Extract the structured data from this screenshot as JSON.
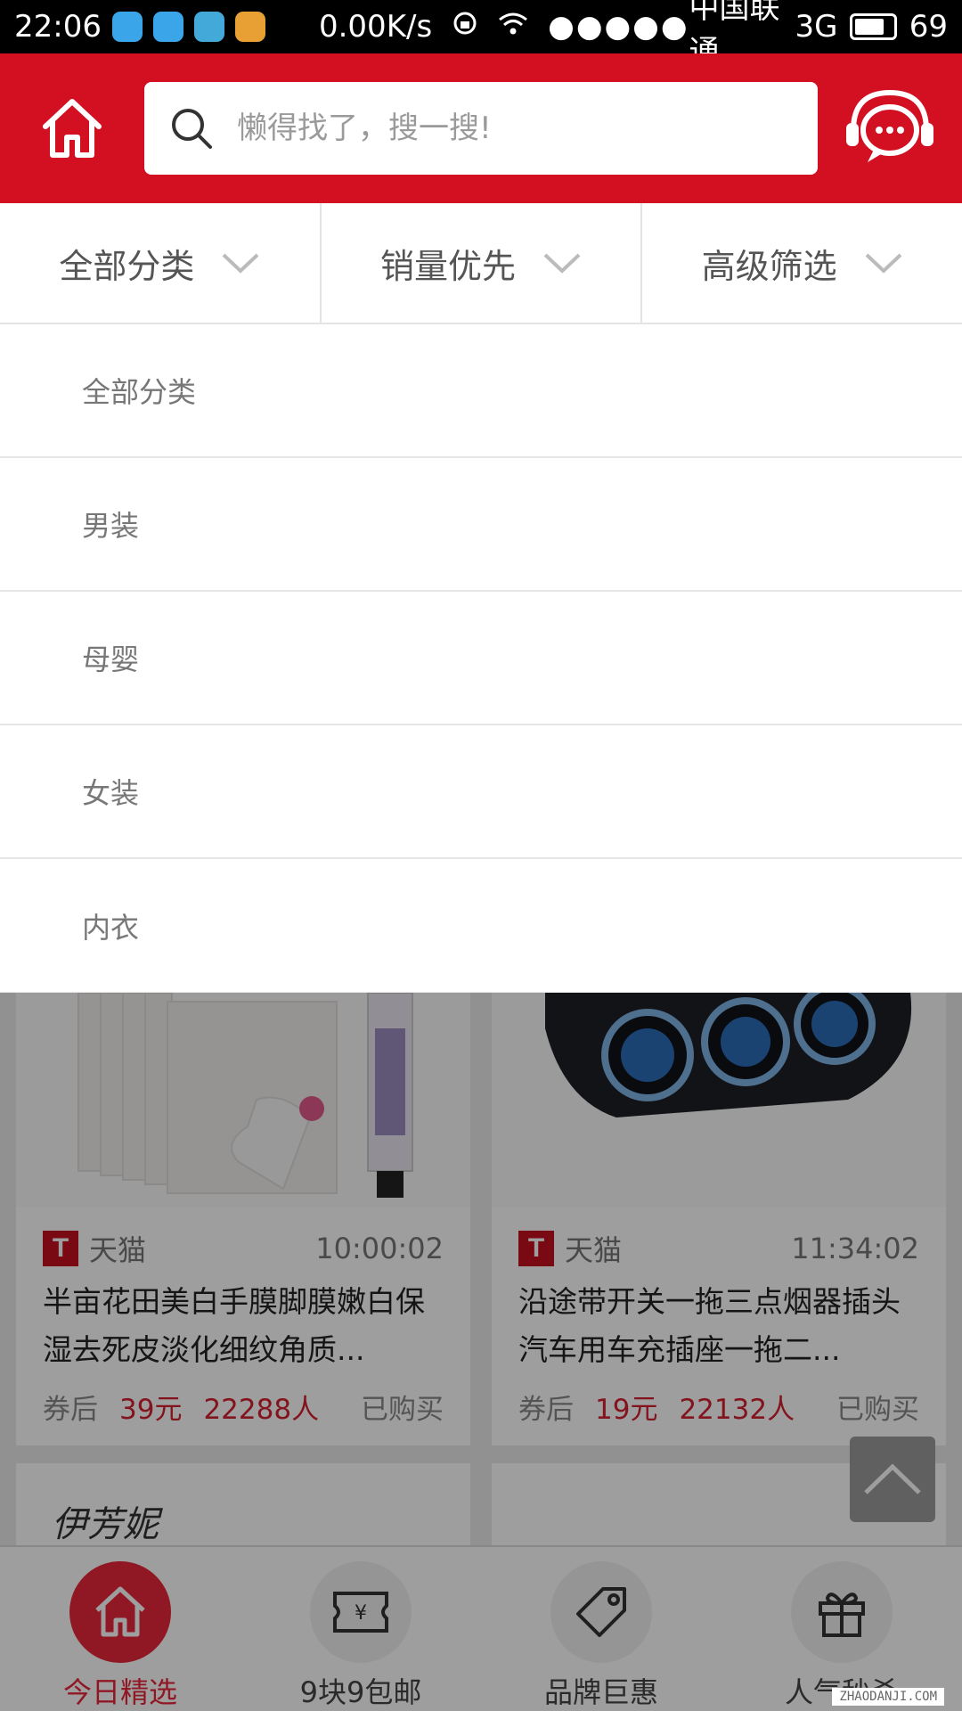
{
  "status_bar": {
    "time": "22:06",
    "net_speed": "0.00K/s",
    "carrier": "中国联通",
    "network": "3G",
    "battery": "69"
  },
  "header": {
    "search_placeholder": "懒得找了，搜一搜!"
  },
  "filters": [
    {
      "label": "全部分类"
    },
    {
      "label": "销量优先"
    },
    {
      "label": "高级筛选"
    }
  ],
  "dropdown": {
    "items": [
      "全部分类",
      "男装",
      "母婴",
      "女装",
      "内衣"
    ]
  },
  "products": [
    {
      "shop": "天猫",
      "shop_badge": "T",
      "time": "10:00:02",
      "title": "半亩花田美白手膜脚膜嫩白保湿去死皮淡化细纹角质...",
      "coupon_label": "券后",
      "price": "39元",
      "buyers": "22288人",
      "bought_label": "已购买"
    },
    {
      "shop": "天猫",
      "shop_badge": "T",
      "time": "11:34:02",
      "title": "沿途带开关一拖三点烟器插头汽车用车充插座一拖二...",
      "coupon_label": "券后",
      "price": "19元",
      "buyers": "22132人",
      "bought_label": "已购买"
    }
  ],
  "brand_logo_text": "伊芳妮",
  "bottom_nav": [
    {
      "label": "今日精选",
      "icon": "home-icon",
      "active": true
    },
    {
      "label": "9块9包邮",
      "icon": "yen-ticket-icon",
      "active": false
    },
    {
      "label": "品牌巨惠",
      "icon": "tag-icon",
      "active": false
    },
    {
      "label": "人气秒杀",
      "icon": "gift-icon",
      "active": false
    }
  ],
  "watermark": "ZHAODANJI.COM",
  "colors": {
    "brand_red": "#d30f22",
    "price_red": "#d41f2e",
    "active_nav": "#e8283a"
  }
}
